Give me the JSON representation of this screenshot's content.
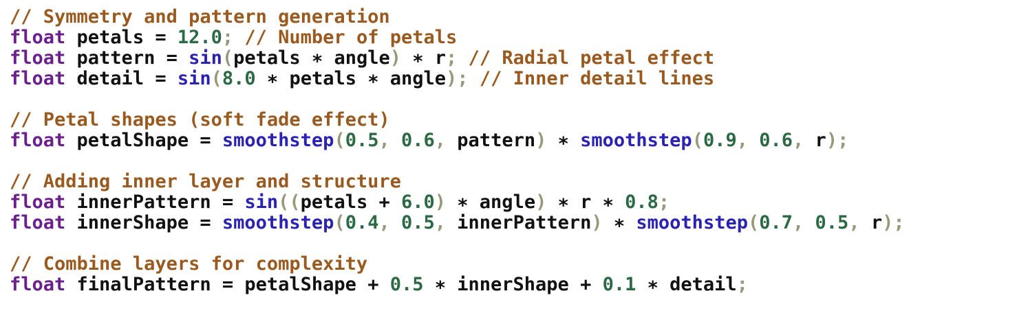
{
  "lines": [
    [
      {
        "kind": "comment",
        "text": "// Symmetry and pattern generation"
      }
    ],
    [
      {
        "kind": "type",
        "text": "float"
      },
      {
        "kind": "ident",
        "text": " petals "
      },
      {
        "kind": "op",
        "text": "= "
      },
      {
        "kind": "num",
        "text": "12.0"
      },
      {
        "kind": "punct",
        "text": "; "
      },
      {
        "kind": "comment",
        "text": "// Number of petals"
      }
    ],
    [
      {
        "kind": "type",
        "text": "float"
      },
      {
        "kind": "ident",
        "text": " pattern "
      },
      {
        "kind": "op",
        "text": "= "
      },
      {
        "kind": "func",
        "text": "sin"
      },
      {
        "kind": "punct",
        "text": "("
      },
      {
        "kind": "ident",
        "text": "petals "
      },
      {
        "kind": "op",
        "text": "∗ "
      },
      {
        "kind": "ident",
        "text": "angle"
      },
      {
        "kind": "punct",
        "text": ") "
      },
      {
        "kind": "op",
        "text": "∗ "
      },
      {
        "kind": "ident",
        "text": "r"
      },
      {
        "kind": "punct",
        "text": "; "
      },
      {
        "kind": "comment",
        "text": "// Radial petal effect"
      }
    ],
    [
      {
        "kind": "type",
        "text": "float"
      },
      {
        "kind": "ident",
        "text": " detail "
      },
      {
        "kind": "op",
        "text": "= "
      },
      {
        "kind": "func",
        "text": "sin"
      },
      {
        "kind": "punct",
        "text": "("
      },
      {
        "kind": "num",
        "text": "8.0 "
      },
      {
        "kind": "op",
        "text": "∗ "
      },
      {
        "kind": "ident",
        "text": "petals "
      },
      {
        "kind": "op",
        "text": "∗ "
      },
      {
        "kind": "ident",
        "text": "angle"
      },
      {
        "kind": "punct",
        "text": "); "
      },
      {
        "kind": "comment",
        "text": "// Inner detail lines"
      }
    ],
    [],
    [
      {
        "kind": "comment",
        "text": "// Petal shapes (soft fade effect)"
      }
    ],
    [
      {
        "kind": "type",
        "text": "float"
      },
      {
        "kind": "ident",
        "text": " petalShape "
      },
      {
        "kind": "op",
        "text": "= "
      },
      {
        "kind": "func",
        "text": "smoothstep"
      },
      {
        "kind": "punct",
        "text": "("
      },
      {
        "kind": "num",
        "text": "0.5"
      },
      {
        "kind": "punct",
        "text": ", "
      },
      {
        "kind": "num",
        "text": "0.6"
      },
      {
        "kind": "punct",
        "text": ", "
      },
      {
        "kind": "ident",
        "text": "pattern"
      },
      {
        "kind": "punct",
        "text": ") "
      },
      {
        "kind": "op",
        "text": "∗ "
      },
      {
        "kind": "func",
        "text": "smoothstep"
      },
      {
        "kind": "punct",
        "text": "("
      },
      {
        "kind": "num",
        "text": "0.9"
      },
      {
        "kind": "punct",
        "text": ", "
      },
      {
        "kind": "num",
        "text": "0.6"
      },
      {
        "kind": "punct",
        "text": ", "
      },
      {
        "kind": "ident",
        "text": "r"
      },
      {
        "kind": "punct",
        "text": ");"
      }
    ],
    [],
    [
      {
        "kind": "comment",
        "text": "// Adding inner layer and structure"
      }
    ],
    [
      {
        "kind": "type",
        "text": "float"
      },
      {
        "kind": "ident",
        "text": " innerPattern "
      },
      {
        "kind": "op",
        "text": "= "
      },
      {
        "kind": "func",
        "text": "sin"
      },
      {
        "kind": "punct",
        "text": "(("
      },
      {
        "kind": "ident",
        "text": "petals "
      },
      {
        "kind": "op",
        "text": "+ "
      },
      {
        "kind": "num",
        "text": "6.0"
      },
      {
        "kind": "punct",
        "text": ") "
      },
      {
        "kind": "op",
        "text": "∗ "
      },
      {
        "kind": "ident",
        "text": "angle"
      },
      {
        "kind": "punct",
        "text": ") "
      },
      {
        "kind": "op",
        "text": "∗ "
      },
      {
        "kind": "ident",
        "text": "r "
      },
      {
        "kind": "op",
        "text": "∗ "
      },
      {
        "kind": "num",
        "text": "0.8"
      },
      {
        "kind": "punct",
        "text": ";"
      }
    ],
    [
      {
        "kind": "type",
        "text": "float"
      },
      {
        "kind": "ident",
        "text": " innerShape "
      },
      {
        "kind": "op",
        "text": "= "
      },
      {
        "kind": "func",
        "text": "smoothstep"
      },
      {
        "kind": "punct",
        "text": "("
      },
      {
        "kind": "num",
        "text": "0.4"
      },
      {
        "kind": "punct",
        "text": ", "
      },
      {
        "kind": "num",
        "text": "0.5"
      },
      {
        "kind": "punct",
        "text": ", "
      },
      {
        "kind": "ident",
        "text": "innerPattern"
      },
      {
        "kind": "punct",
        "text": ") "
      },
      {
        "kind": "op",
        "text": "∗ "
      },
      {
        "kind": "func",
        "text": "smoothstep"
      },
      {
        "kind": "punct",
        "text": "("
      },
      {
        "kind": "num",
        "text": "0.7"
      },
      {
        "kind": "punct",
        "text": ", "
      },
      {
        "kind": "num",
        "text": "0.5"
      },
      {
        "kind": "punct",
        "text": ", "
      },
      {
        "kind": "ident",
        "text": "r"
      },
      {
        "kind": "punct",
        "text": ");"
      }
    ],
    [],
    [
      {
        "kind": "comment",
        "text": "// Combine layers for complexity"
      }
    ],
    [
      {
        "kind": "type",
        "text": "float"
      },
      {
        "kind": "ident",
        "text": " finalPattern "
      },
      {
        "kind": "op",
        "text": "= "
      },
      {
        "kind": "ident",
        "text": "petalShape "
      },
      {
        "kind": "op",
        "text": "+ "
      },
      {
        "kind": "num",
        "text": "0.5 "
      },
      {
        "kind": "op",
        "text": "∗ "
      },
      {
        "kind": "ident",
        "text": "innerShape "
      },
      {
        "kind": "op",
        "text": "+ "
      },
      {
        "kind": "num",
        "text": "0.1 "
      },
      {
        "kind": "op",
        "text": "∗ "
      },
      {
        "kind": "ident",
        "text": "detail"
      },
      {
        "kind": "punct",
        "text": ";"
      }
    ]
  ],
  "colors": {
    "comment": "#9a5a1f",
    "type": "#6a1f8a",
    "identifier": "#111111",
    "function": "#2a22b0",
    "number": "#2b6a44",
    "punctuation": "#97997a",
    "background": "#ffffff"
  }
}
